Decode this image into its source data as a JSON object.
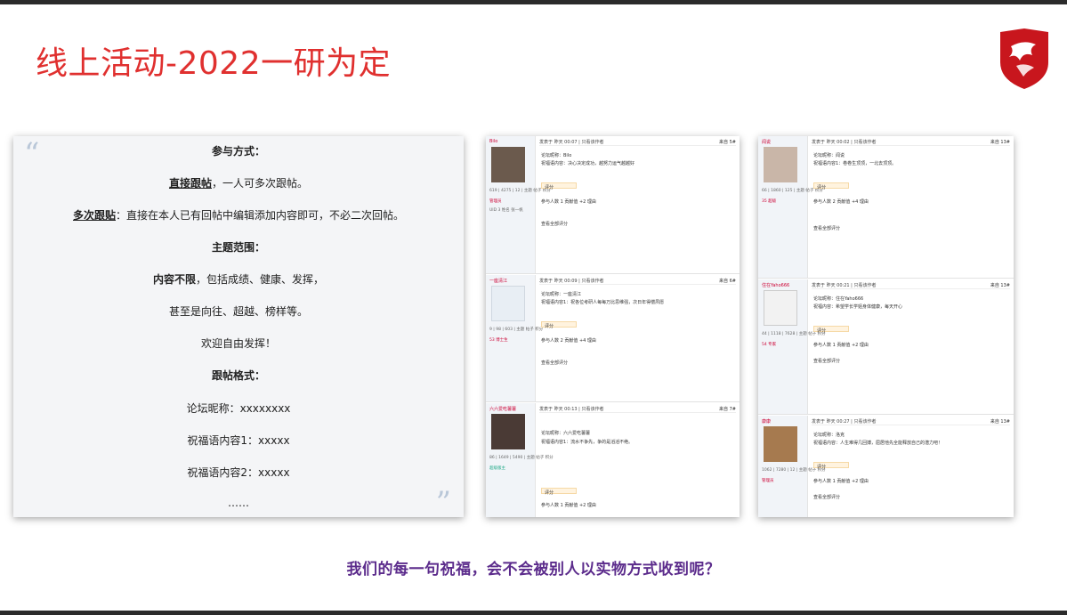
{
  "slide": {
    "title": "线上活动-2022一研为定",
    "caption": "我们的每一句祝福，会不会被别人以实物方式收到呢？"
  },
  "rules_card": {
    "participation_heading": "参与方式：",
    "method1_bold": "直接跟帖",
    "method1_rest": "，一人可多次跟帖。",
    "method2_bold": "多次跟贴",
    "method2_rest": "：直接在本人已有回帖中编辑添加内容即可，不必二次回帖。",
    "topic_heading": "主题范围：",
    "topic_bold": "内容不限",
    "topic_rest": "，包括成绩、健康、发挥，",
    "topic_line2": "甚至是向往、超越、榜样等。",
    "welcome": "欢迎自由发挥！",
    "format_heading": "跟帖格式：",
    "format_nick": "论坛昵称：xxxxxxxx",
    "format_c1": "祝福语内容1：xxxxx",
    "format_c2": "祝福语内容2：xxxxx",
    "ellipsis": "……"
  },
  "colors": {
    "title": "#e0302f",
    "caption": "#5c2c8c",
    "logo": "#c8161d"
  },
  "screenshot1": {
    "posts": [
      {
        "user": "Bilo",
        "meta": "发表于 昨天 00:07 | 只看该作者",
        "floor": "来自 5#",
        "l1": "论坛昵称：Bilo",
        "l2": "祝福语内容：决心决定成功，越努力运气越越好",
        "rate": "评分",
        "f1": "参与人数 1  贡献值 +2 理由",
        "f2": "查看全部评分"
      },
      {
        "user": "一座清江",
        "meta": "发表于 昨天 00:09 | 只看该作者",
        "floor": "来自 6#",
        "l1": "论坛昵称：一座清江",
        "l2": "祝福语内容1：祝各位考研人每每万比思维强，次日年得偿夙愿",
        "rate": "评分",
        "f1": "参与人数 2  贡献值 +4 理由",
        "f2": "查看全部评分"
      },
      {
        "user": "六六爱吃薯薯",
        "meta": "发表于 昨天 00:13 | 只看该作者",
        "floor": "来自 7#",
        "l1": "论坛昵称：六六爱吃薯薯",
        "l2": "祝福语内容1：流水不争先，争的是滔滔不绝。",
        "rate": "评分",
        "f1": "参与人数 1  贡献值 +2 理由",
        "f2": ""
      }
    ]
  },
  "screenshot2": {
    "posts": [
      {
        "user": "闻说",
        "meta": "发表于 昨天 00:02 | 只看该作者",
        "floor": "来自 13#",
        "l1": "论坛昵称：闻说",
        "l2": "祝福语内容1：卷卷生顶顶，一北去顶顶。",
        "rate": "评分",
        "f1": "参与人数 2  贡献值 +4 理由",
        "f2": "查看全部评分"
      },
      {
        "user": "住在Yaho666",
        "meta": "发表于 昨天 00:21 | 只看该作者",
        "floor": "来自 13#",
        "l1": "论坛昵称：住在Yaho666",
        "l2": "祝福内容：希望学长学姐身体健康，每天开心",
        "rate": "评分",
        "f1": "参与人数 1  贡献值 +2 理由",
        "f2": "查看全部评分"
      },
      {
        "user": "康康",
        "meta": "发表于 昨天 00:27 | 只看该作者",
        "floor": "来自 13#",
        "l1": "论坛昵称：洛克",
        "l2": "祝福语内容：人生难得几回搏，屈居他先全能释放自己的潜力吧！",
        "rate": "评分",
        "f1": "参与人数 1  贡献值 +2 理由",
        "f2": "查看全部评分"
      }
    ]
  }
}
